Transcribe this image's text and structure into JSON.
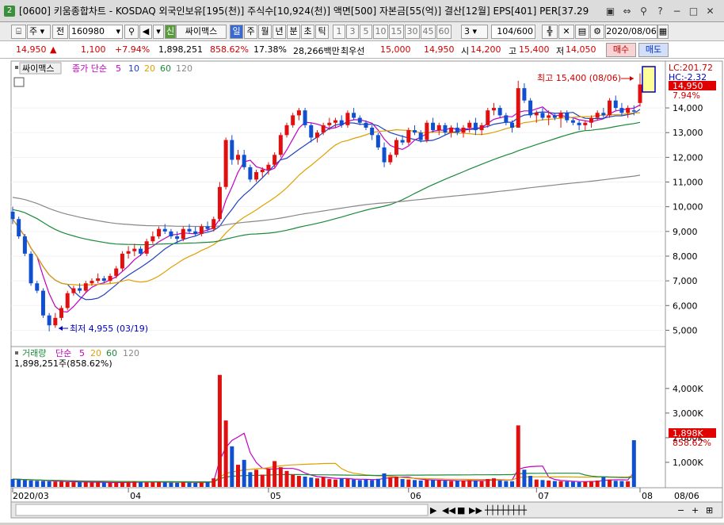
{
  "title": {
    "window_number": "2",
    "text": "[0600] 키움종합차트 - KOSDAQ 외국인보유[195(천)] 주식수[10,924(천)] 액면[500] 자본금[55(억)] 결산[12월] EPS[401] PER[37.29"
  },
  "toolbar": {
    "mode": "주",
    "jeon": "전",
    "code": "160980",
    "stock_tag": "신",
    "stock_name": "싸이맥스",
    "periods": [
      "일",
      "주",
      "월",
      "년",
      "분",
      "초",
      "틱"
    ],
    "minutes": [
      "1",
      "3",
      "5",
      "10",
      "15",
      "30",
      "45",
      "60"
    ],
    "interval": "3",
    "count": "104",
    "total": "/600",
    "date": "2020/08/06"
  },
  "quote": {
    "price": "14,950",
    "arrow": "▲",
    "change": "1,100",
    "rate": "+7.94%",
    "volume": "1,898,251",
    "vol_ratio": "858.62%",
    "turnover": "17.38%",
    "amount": "28,266백만",
    "best_label": "최우선",
    "best_ask": "15,000",
    "best_bid": "14,950",
    "open_label": "시",
    "open": "14,200",
    "high_label": "고",
    "high": "15,400",
    "low_label": "저",
    "low": "14,050",
    "buy": "매수",
    "sell": "매도"
  },
  "legend_price": {
    "name": "싸이맥스",
    "ma_label": "종가 단순",
    "ma": [
      "5",
      "10",
      "20",
      "60",
      "120"
    ]
  },
  "legend_vol": {
    "name": "거래량",
    "ma_label": "단순",
    "ma": [
      "5",
      "20",
      "60",
      "120"
    ],
    "value": "1,898,251주(858.62%)"
  },
  "annotations": {
    "high": "최고 15,400 (08/06)",
    "low": "최저 4,955 (03/19)",
    "lc": "LC:201.72",
    "hc": "HC:-2.32",
    "cur_price": "14,950",
    "cur_rate": "7.94%",
    "vol_tag": "1,898K",
    "vol_rate": "858.62%"
  },
  "y_labels": [
    "14,000",
    "13,000",
    "12,000",
    "11,000",
    "10,000",
    "9,000",
    "8,000",
    "7,000",
    "6,000",
    "5,000"
  ],
  "vol_labels": [
    "4,000K",
    "3,000K",
    "2,000K",
    "1,000K"
  ],
  "x_labels": [
    "2020/03",
    "04",
    "05",
    "06",
    "07",
    "08",
    "08/06"
  ],
  "chart_data": {
    "type": "candlestick",
    "price_ylim": [
      4500,
      15800
    ],
    "volume_ylim": [
      0,
      4800000
    ],
    "ohlc": [
      [
        9800,
        10000,
        9300,
        9500
      ],
      [
        9500,
        9600,
        8700,
        8800
      ],
      [
        8800,
        8900,
        8000,
        8100
      ],
      [
        8100,
        8200,
        6800,
        6900
      ],
      [
        6900,
        7000,
        6500,
        6600
      ],
      [
        6600,
        6700,
        5500,
        5600
      ],
      [
        5600,
        5700,
        4955,
        5200
      ],
      [
        5200,
        5700,
        5100,
        5500
      ],
      [
        5500,
        6000,
        5400,
        5900
      ],
      [
        5900,
        6600,
        5800,
        6500
      ],
      [
        6500,
        6800,
        6400,
        6700
      ],
      [
        6700,
        6900,
        6500,
        6600
      ],
      [
        6600,
        7000,
        6500,
        6900
      ],
      [
        6900,
        7100,
        6800,
        7000
      ],
      [
        7000,
        7300,
        6900,
        7100
      ],
      [
        7100,
        7200,
        6900,
        7000
      ],
      [
        7000,
        7300,
        6900,
        7200
      ],
      [
        7200,
        7600,
        7100,
        7500
      ],
      [
        7500,
        8200,
        7400,
        8100
      ],
      [
        8100,
        8400,
        7900,
        8200
      ],
      [
        8200,
        8500,
        8000,
        8300
      ],
      [
        8300,
        8400,
        8000,
        8100
      ],
      [
        8100,
        8700,
        8000,
        8600
      ],
      [
        8600,
        9000,
        8500,
        8800
      ],
      [
        8800,
        9200,
        8700,
        9100
      ],
      [
        9100,
        9300,
        8900,
        9000
      ],
      [
        9000,
        9100,
        8700,
        8800
      ],
      [
        8800,
        9000,
        8500,
        8700
      ],
      [
        8700,
        9200,
        8600,
        9100
      ],
      [
        9100,
        9300,
        8900,
        9000
      ],
      [
        9000,
        9200,
        8800,
        8900
      ],
      [
        8900,
        9300,
        8800,
        9200
      ],
      [
        9200,
        9400,
        9000,
        9100
      ],
      [
        9100,
        9600,
        9000,
        9500
      ],
      [
        9500,
        11000,
        9400,
        10800
      ],
      [
        10800,
        12800,
        10700,
        12700
      ],
      [
        12700,
        12900,
        11700,
        11900
      ],
      [
        11900,
        12300,
        11700,
        12100
      ],
      [
        12100,
        12300,
        11500,
        11600
      ],
      [
        11600,
        11700,
        11000,
        11100
      ],
      [
        11100,
        11500,
        11000,
        11400
      ],
      [
        11400,
        11600,
        11200,
        11500
      ],
      [
        11500,
        11800,
        11300,
        11700
      ],
      [
        11700,
        12200,
        11600,
        12100
      ],
      [
        12100,
        13000,
        12000,
        12900
      ],
      [
        12900,
        13400,
        12800,
        13300
      ],
      [
        13300,
        13800,
        13200,
        13700
      ],
      [
        13700,
        14000,
        13500,
        13900
      ],
      [
        13900,
        14000,
        13200,
        13300
      ],
      [
        13300,
        13400,
        12600,
        12800
      ],
      [
        12800,
        13100,
        12600,
        13000
      ],
      [
        13000,
        13400,
        12900,
        13300
      ],
      [
        13300,
        13600,
        13100,
        13400
      ],
      [
        13400,
        13600,
        13200,
        13500
      ],
      [
        13500,
        13700,
        13200,
        13300
      ],
      [
        13300,
        13900,
        13200,
        13800
      ],
      [
        13800,
        14000,
        13500,
        13600
      ],
      [
        13600,
        13700,
        13300,
        13400
      ],
      [
        13400,
        13500,
        13100,
        13200
      ],
      [
        13200,
        13300,
        12700,
        12900
      ],
      [
        12900,
        13000,
        12300,
        12400
      ],
      [
        12400,
        12600,
        11600,
        11800
      ],
      [
        11800,
        12200,
        11700,
        12100
      ],
      [
        12100,
        12800,
        12000,
        12700
      ],
      [
        12700,
        12900,
        12500,
        12600
      ],
      [
        12600,
        13200,
        12500,
        13100
      ],
      [
        13100,
        13300,
        12900,
        13000
      ],
      [
        13000,
        13100,
        12600,
        12700
      ],
      [
        12700,
        13500,
        12600,
        13400
      ],
      [
        13400,
        13600,
        13000,
        13100
      ],
      [
        13100,
        13400,
        12900,
        13300
      ],
      [
        13300,
        13400,
        12900,
        13000
      ],
      [
        13000,
        13300,
        12800,
        13200
      ],
      [
        13200,
        13400,
        12900,
        13000
      ],
      [
        13000,
        13300,
        12800,
        13200
      ],
      [
        13200,
        13500,
        13000,
        13400
      ],
      [
        13400,
        13600,
        12900,
        13100
      ],
      [
        13100,
        13400,
        12900,
        13300
      ],
      [
        13300,
        14000,
        13200,
        13900
      ],
      [
        13900,
        14200,
        13700,
        14000
      ],
      [
        14000,
        14100,
        13600,
        13700
      ],
      [
        13700,
        13800,
        13300,
        13400
      ],
      [
        13400,
        13500,
        13000,
        13200
      ],
      [
        13200,
        15100,
        13200,
        14800
      ],
      [
        14800,
        15000,
        14200,
        14300
      ],
      [
        14300,
        14400,
        13600,
        13700
      ],
      [
        13700,
        13900,
        13400,
        13800
      ],
      [
        13800,
        14000,
        13500,
        13600
      ],
      [
        13600,
        13900,
        13300,
        13700
      ],
      [
        13700,
        13800,
        13500,
        13600
      ],
      [
        13600,
        13900,
        13200,
        13800
      ],
      [
        13800,
        13900,
        13400,
        13500
      ],
      [
        13500,
        13600,
        13300,
        13400
      ],
      [
        13400,
        13500,
        13100,
        13300
      ],
      [
        13300,
        13500,
        13100,
        13400
      ],
      [
        13400,
        13700,
        13200,
        13600
      ],
      [
        13600,
        13900,
        13500,
        13800
      ],
      [
        13800,
        14000,
        13600,
        13700
      ],
      [
        13700,
        14400,
        13600,
        14300
      ],
      [
        14300,
        14500,
        13900,
        14000
      ],
      [
        14000,
        14200,
        13700,
        13800
      ],
      [
        13800,
        14100,
        13600,
        14000
      ],
      [
        13900,
        14100,
        13700,
        13850
      ],
      [
        14200,
        15400,
        14050,
        14950
      ]
    ],
    "volume": [
      320000,
      300000,
      280000,
      260000,
      250000,
      240000,
      230000,
      220000,
      210000,
      200000,
      190000,
      200000,
      190000,
      180000,
      190000,
      180000,
      170000,
      180000,
      190000,
      200000,
      210000,
      190000,
      180000,
      190000,
      200000,
      190000,
      180000,
      170000,
      190000,
      180000,
      170000,
      180000,
      190000,
      350000,
      4550000,
      2700000,
      1650000,
      900000,
      1100000,
      600000,
      700000,
      500000,
      750000,
      1050000,
      800000,
      650000,
      500000,
      450000,
      420000,
      380000,
      350000,
      400000,
      320000,
      300000,
      350000,
      330000,
      300000,
      280000,
      300000,
      280000,
      330000,
      550000,
      400000,
      420000,
      320000,
      300000,
      280000,
      260000,
      300000,
      280000,
      260000,
      250000,
      240000,
      250000,
      260000,
      280000,
      250000,
      230000,
      320000,
      350000,
      260000,
      240000,
      230000,
      2500000,
      700000,
      450000,
      300000,
      280000,
      260000,
      240000,
      230000,
      220000,
      210000,
      200000,
      220000,
      240000,
      260000,
      400000,
      300000,
      250000,
      240000,
      230000,
      1898251
    ]
  }
}
